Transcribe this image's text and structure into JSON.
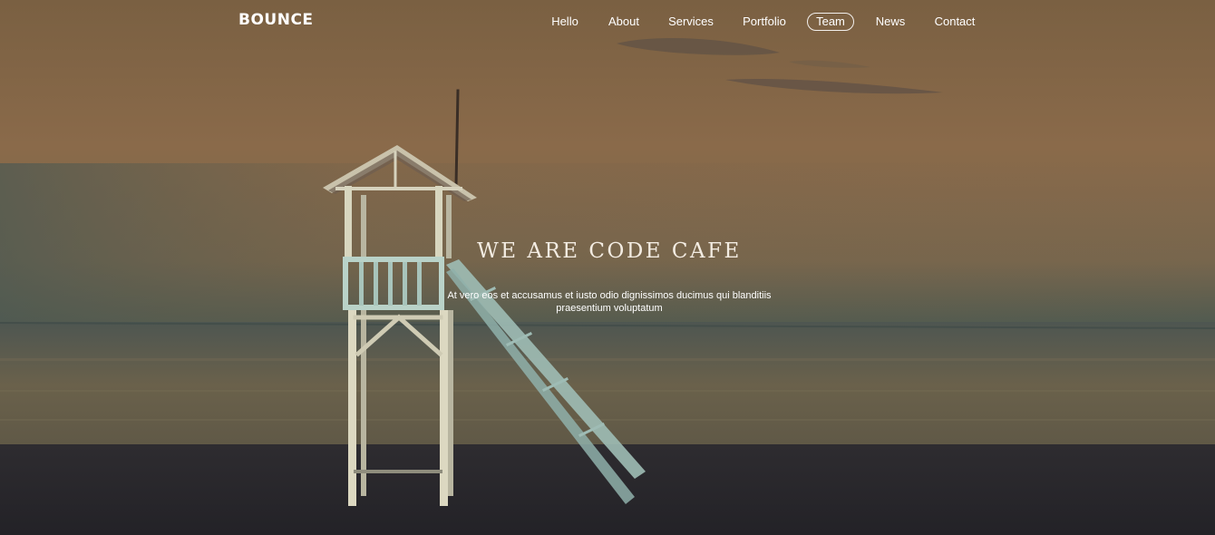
{
  "brand": {
    "logo_text": "BOUNCE"
  },
  "nav": {
    "items": [
      {
        "label": "Hello",
        "active": false
      },
      {
        "label": "About",
        "active": false
      },
      {
        "label": "Services",
        "active": false
      },
      {
        "label": "Portfolio",
        "active": false
      },
      {
        "label": "Team",
        "active": true
      },
      {
        "label": "News",
        "active": false
      },
      {
        "label": "Contact",
        "active": false
      }
    ]
  },
  "hero": {
    "title": "WE ARE CODE CAFE",
    "text": "At vero eos et accusamus et iusto odio dignissimos ducimus qui blanditiis praesentium voluptatum"
  },
  "colors": {
    "sky_top": "#7e6446",
    "sky_mid": "#8f6f4e",
    "sea": "#5e5a48",
    "sand": "#2a2930",
    "tower": "#d8d8bd",
    "ramp": "#a9c8c0",
    "text": "#ffffff"
  }
}
